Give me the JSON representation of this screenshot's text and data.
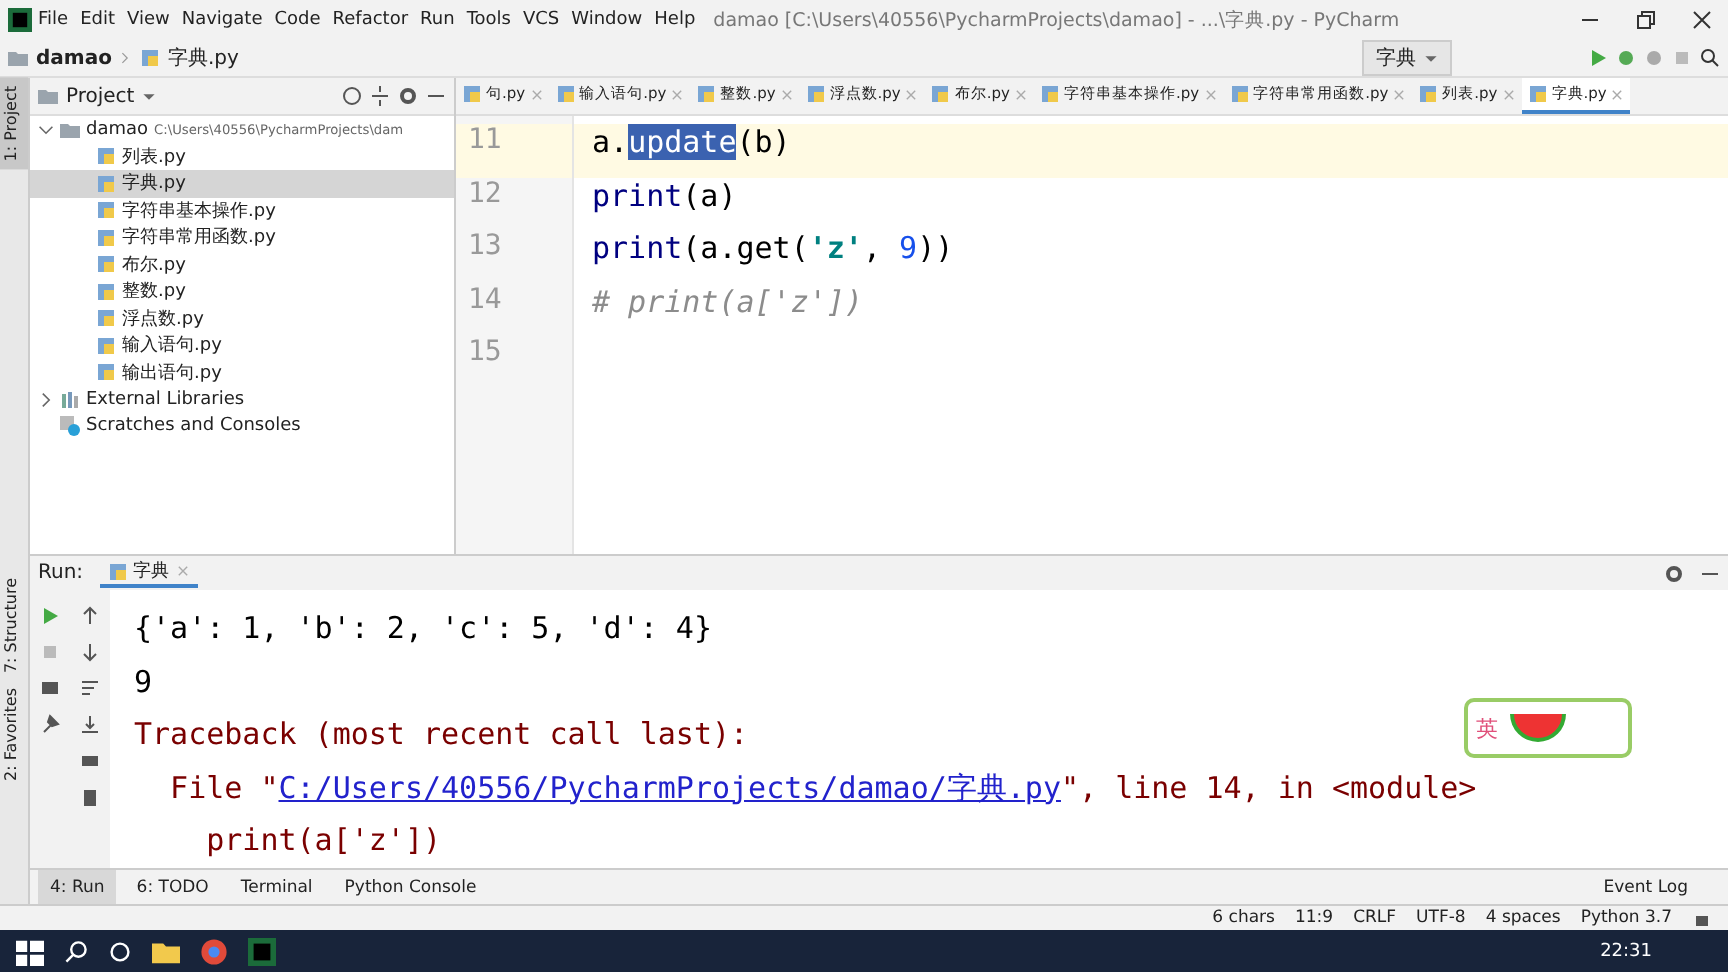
{
  "menu": [
    "File",
    "Edit",
    "View",
    "Navigate",
    "Code",
    "Refactor",
    "Run",
    "Tools",
    "VCS",
    "Window",
    "Help"
  ],
  "window_title": "damao [C:\\Users\\40556\\PycharmProjects\\damao] - ...\\字典.py - PyCharm",
  "breadcrumbs": [
    "damao",
    "字典.py"
  ],
  "run_config": "字典",
  "left_strip": [
    {
      "label": "1: Project",
      "selected": true
    },
    {
      "label": "7: Structure",
      "selected": false
    },
    {
      "label": "2: Favorites",
      "selected": false
    }
  ],
  "project_panel": {
    "title": "Project",
    "tree": [
      {
        "kind": "folder",
        "label": "damao",
        "path": "C:\\Users\\40556\\PycharmProjects\\dam",
        "expanded": true,
        "selected": false,
        "children": [
          {
            "kind": "file",
            "label": "列表.py",
            "selected": false
          },
          {
            "kind": "file",
            "label": "字典.py",
            "selected": true
          },
          {
            "kind": "file",
            "label": "字符串基本操作.py",
            "selected": false
          },
          {
            "kind": "file",
            "label": "字符串常用函数.py",
            "selected": false
          },
          {
            "kind": "file",
            "label": "布尔.py",
            "selected": false
          },
          {
            "kind": "file",
            "label": "整数.py",
            "selected": false
          },
          {
            "kind": "file",
            "label": "浮点数.py",
            "selected": false
          },
          {
            "kind": "file",
            "label": "输入语句.py",
            "selected": false
          },
          {
            "kind": "file",
            "label": "输出语句.py",
            "selected": false
          }
        ]
      },
      {
        "kind": "library",
        "label": "External Libraries",
        "expanded": false,
        "selected": false
      },
      {
        "kind": "scratches",
        "label": "Scratches and Consoles",
        "selected": false
      }
    ]
  },
  "editor_tabs": [
    {
      "label": "句.py",
      "selected": false
    },
    {
      "label": "输入语句.py",
      "selected": false
    },
    {
      "label": "整数.py",
      "selected": false
    },
    {
      "label": "浮点数.py",
      "selected": false
    },
    {
      "label": "布尔.py",
      "selected": false
    },
    {
      "label": "字符串基本操作.py",
      "selected": false
    },
    {
      "label": "字符串常用函数.py",
      "selected": false
    },
    {
      "label": "列表.py",
      "selected": false
    },
    {
      "label": "字典.py",
      "selected": true
    }
  ],
  "code_lines": [
    {
      "number": "11",
      "current": true,
      "tokens": [
        {
          "kind": "plain",
          "text": "a."
        },
        {
          "kind": "selected",
          "text": "update"
        },
        {
          "kind": "plain",
          "text": "(b)"
        }
      ]
    },
    {
      "number": "12",
      "current": false,
      "tokens": [
        {
          "kind": "builtin",
          "text": "print"
        },
        {
          "kind": "plain",
          "text": "(a)"
        }
      ]
    },
    {
      "number": "13",
      "current": false,
      "tokens": [
        {
          "kind": "builtin",
          "text": "print"
        },
        {
          "kind": "plain",
          "text": "(a.get("
        },
        {
          "kind": "string",
          "text": "'z'"
        },
        {
          "kind": "plain",
          "text": ", "
        },
        {
          "kind": "number",
          "text": "9"
        },
        {
          "kind": "plain",
          "text": "))"
        }
      ]
    },
    {
      "number": "14",
      "current": false,
      "tokens": [
        {
          "kind": "comment",
          "text": "# print(a['z'])"
        }
      ]
    },
    {
      "number": "15",
      "current": false
    }
  ],
  "run_panel": {
    "label": "Run:",
    "tab": "字典",
    "output": [
      [
        {
          "kind": "normal",
          "text": "{'a': 1, 'b': 2, 'c': 5, 'd': 4}"
        }
      ],
      [
        {
          "kind": "normal",
          "text": "9"
        }
      ],
      [
        {
          "kind": "error",
          "text": "Traceback (most recent call last):"
        }
      ],
      [
        {
          "kind": "error",
          "text": "  File \""
        },
        {
          "kind": "link",
          "text": "C:/Users/40556/PycharmProjects/damao/字典.py"
        },
        {
          "kind": "error",
          "text": "\", line 14, in <module>"
        }
      ],
      [
        {
          "kind": "error",
          "text": "    print(a['z'])"
        }
      ]
    ]
  },
  "ime": {
    "label": "英"
  },
  "bottom_tabs": [
    {
      "label": "4: Run",
      "selected": true
    },
    {
      "label": "6: TODO",
      "selected": false
    },
    {
      "label": "Terminal",
      "selected": false
    },
    {
      "label": "Python Console",
      "selected": false
    }
  ],
  "event_log": "Event Log",
  "status": [
    "6 chars",
    "11:9",
    "CRLF",
    "UTF-8",
    "4 spaces",
    "Python 3.7"
  ],
  "clock": "22:31"
}
